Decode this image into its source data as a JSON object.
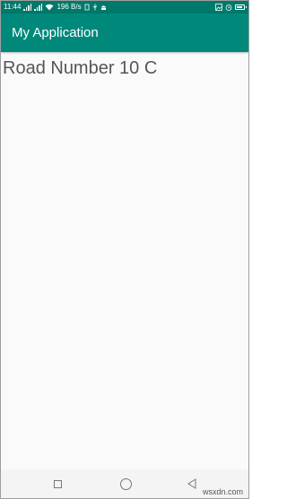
{
  "status_bar": {
    "time": "11:44",
    "network_speed": "196 B/s",
    "battery_level": 0.85,
    "icons": [
      "signal-icon",
      "wifi-icon",
      "alarm-icon",
      "battery-icon"
    ]
  },
  "app_bar": {
    "title": "My Application",
    "color": "#00897b"
  },
  "content": {
    "text": "Road Number 10 C"
  },
  "nav_bar": {
    "buttons": [
      "recents-button",
      "home-button",
      "back-button"
    ]
  },
  "watermark": "wsxdn.com"
}
